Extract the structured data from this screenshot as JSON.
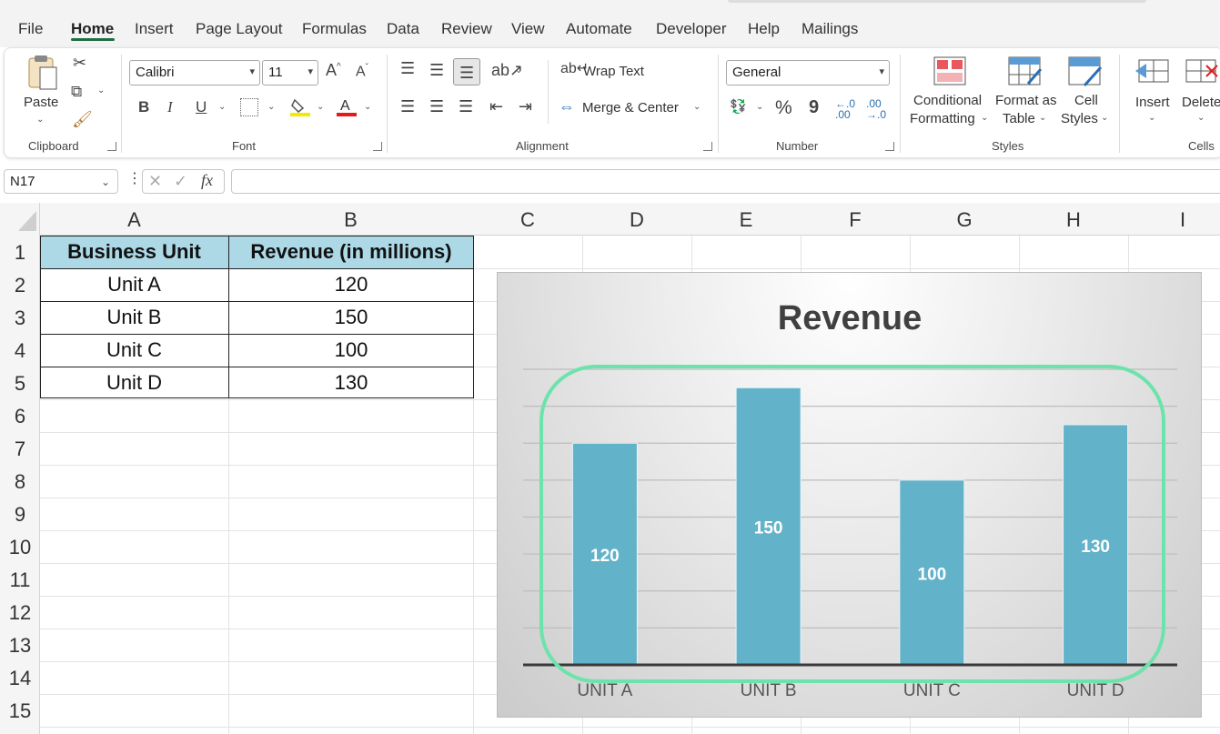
{
  "menu": {
    "tabs": [
      "File",
      "Home",
      "Insert",
      "Page Layout",
      "Formulas",
      "Data",
      "Review",
      "View",
      "Automate",
      "Developer",
      "Help",
      "Mailings"
    ]
  },
  "ribbon": {
    "clipboard": {
      "paste_label": "Paste",
      "group_label": "Clipboard"
    },
    "font": {
      "font_name": "Calibri",
      "font_size": "11",
      "group_label": "Font",
      "bold": "B",
      "italic": "I",
      "underline": "U"
    },
    "alignment": {
      "wrap_text": "Wrap Text",
      "merge_center": "Merge & Center",
      "group_label": "Alignment"
    },
    "number": {
      "format": "General",
      "percent": "%",
      "comma": "9",
      "group_label": "Number"
    },
    "styles": {
      "conditional_formatting_line1": "Conditional",
      "conditional_formatting_line2": "Formatting",
      "format_as_table_line1": "Format as",
      "format_as_table_line2": "Table",
      "cell_styles_line1": "Cell",
      "cell_styles_line2": "Styles",
      "group_label": "Styles"
    },
    "cells": {
      "insert": "Insert",
      "delete": "Delete",
      "group_label": "Cells"
    }
  },
  "formula_bar": {
    "name_box": "N17",
    "fx": "fx",
    "formula": ""
  },
  "columns": [
    "A",
    "B",
    "C",
    "D",
    "E",
    "F",
    "G",
    "H",
    "I"
  ],
  "rows": [
    "1",
    "2",
    "3",
    "4",
    "5",
    "6",
    "7",
    "8",
    "9",
    "10",
    "11",
    "12",
    "13",
    "14",
    "15"
  ],
  "table": {
    "headers": [
      "Business Unit",
      "Revenue (in millions)"
    ],
    "rows": [
      [
        "Unit A",
        "120"
      ],
      [
        "Unit B",
        "150"
      ],
      [
        "Unit C",
        "100"
      ],
      [
        "Unit D",
        "130"
      ]
    ]
  },
  "colors": {
    "bar": "#62b2ca",
    "highlight": "#6de3ac",
    "header_fill": "#add8e6",
    "accent": "#1f6e43"
  },
  "chart_data": {
    "type": "bar",
    "title": "Revenue",
    "categories": [
      "UNIT A",
      "UNIT B",
      "UNIT C",
      "UNIT D"
    ],
    "values": [
      120,
      150,
      100,
      130
    ],
    "data_labels": [
      "120",
      "150",
      "100",
      "130"
    ],
    "ylim": [
      0,
      160
    ],
    "grid": true,
    "legend": "none"
  }
}
